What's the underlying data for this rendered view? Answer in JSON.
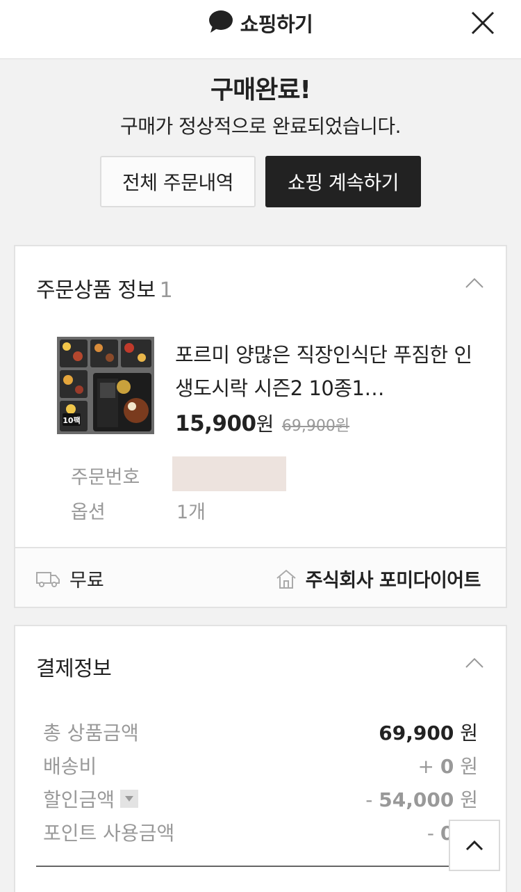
{
  "header": {
    "title": "쇼핑하기",
    "brand_icon": "speech-bubble-icon",
    "close_icon": "close-icon"
  },
  "completion": {
    "title": "구매완료!",
    "subtitle": "구매가 정상적으로 완료되었습니다.",
    "btn_orders": "전체 주문내역",
    "btn_continue": "쇼핑 계속하기"
  },
  "order": {
    "section_title": "주문상품 정보",
    "count": "1",
    "product": {
      "name": "포르미 양많은 직장인식단 푸짐한 인생도시락 시즌2 10종1…",
      "price": "15,900",
      "price_unit": "원",
      "original_price": "69,900원",
      "badge": "10팩"
    },
    "meta": {
      "order_no_label": "주문번호",
      "option_label": "옵션",
      "option_value": "1개"
    },
    "shipping": "무료",
    "seller": "주식회사 포미다이어트"
  },
  "payment": {
    "section_title": "결제정보",
    "rows": {
      "total_label": "총 상품금액",
      "total_value": "69,900",
      "delivery_label": "배송비",
      "delivery_sign": "+",
      "delivery_value": "0",
      "discount_label": "할인금액",
      "discount_sign": "-",
      "discount_value": "54,000",
      "point_label": "포인트 사용금액",
      "point_sign": "-",
      "point_value": "0"
    },
    "unit": "원"
  },
  "colors": {
    "primary_dark": "#222222",
    "muted": "#999999",
    "background": "#f2f2f2",
    "masked": "#ede3de"
  }
}
